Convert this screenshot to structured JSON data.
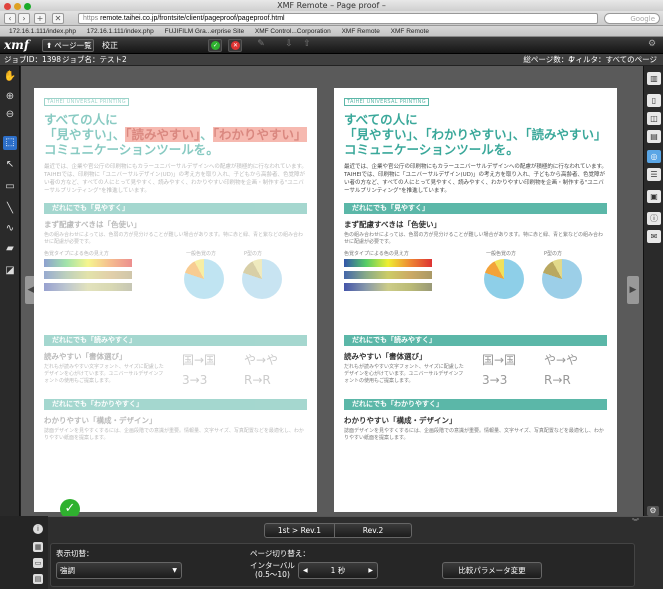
{
  "window": {
    "title": "XMF Remote – Page proof –"
  },
  "browser": {
    "url_prefix": "https",
    "url": "remote.taihei.co.jp/frontsite/client/pageproof/pageproof.html",
    "search_placeholder": "Google"
  },
  "bookmarks": [
    "172.16.1.111/index.php",
    "172.16.1.111/index.php",
    "FUJIFILM Gra...erprise Site",
    "XMF Control...Corporation",
    "XMF Remote",
    "XMF Remote"
  ],
  "toolbar": {
    "logo": "xmf",
    "page_list_label": "ページ一覧",
    "mode_label": "校正"
  },
  "info": {
    "job_id": "ジョブID：1398",
    "job_name": "ジョブ名：テスト2",
    "total_pages": "総ページ数：4",
    "filter": "フィルタ：すべてのページ"
  },
  "page": {
    "brand": "TAIHEI UNIVERSAL PRINTING",
    "title_line1": "すべての人に",
    "title_q1": "「見やすい」、",
    "title_q2": "「読みやすい」",
    "title_sep": "、",
    "title_q3": "「わかりやすい」",
    "title_line3": "コミュニケーションツールを。",
    "intro": "最近では、企業や官公庁の印刷物にもカラーユニバーサルデザインへの配慮が積極的に行なわれています。TAIHEIでは、印刷物に「ユニバーサルデザイン(UD)」の考え方を取り入れ、子どもから高齢者、色覚障がい者の方など、すべての人にとって見やすく、読みやすく、わかりやすい印刷物を企画・制作する\"ユニバーサルプリンティング\"を推進しています。",
    "sec1_band": "だれにでも「見やすく」",
    "sec1_sub": "まず配慮すべきは「色使い」",
    "sec1_text": "色の組み合わせによっては、色弱の方が見分けることが難しい場合があります。特に赤と緑、青と紫などの組み合わせに配慮が必要です。",
    "chart_label_a": "色覚タイプによる色の見え方",
    "chart_label_b": "一般色覚の方",
    "chart_label_c": "P型の方",
    "sec2_band": "だれにでも「読みやすく」",
    "sec2_sub": "読みやすい「書体選び」",
    "sec2_text": "だれもが読みやすい文字フォント、サイズに配慮したデザインを心がけています。ユニバーサルデザインフォントの使用もご提案します。",
    "glyph1": "国→国",
    "glyph2": "や→や",
    "glyph3": "3→3",
    "glyph4": "R→R",
    "sec3_band": "だれにでも「わかりやすく」",
    "sec3_sub": "わかりやすい「構成・デザイン」",
    "sec3_text": "誌面デザインを見やすくするには、企画段階での意識が重要。情報量、文字サイズ、写真配置などを最適化し、わかりやすい紙面を提案します。"
  },
  "bottom": {
    "rev1_label": "1st > Rev.1",
    "rev2_label": "Rev.2",
    "display_switch_label": "表示切替：",
    "display_mode": "強調",
    "page_switch_label": "ページ切り替え：",
    "interval_label": "インターバル",
    "interval_range": "(0.5〜10)",
    "interval_value": "1 秒",
    "compare_button": "比較パラメータ変更"
  },
  "colors": {
    "accent": "#5bb7a8",
    "highlight": "#f18c7d",
    "selected_tool": "#2d6fc9",
    "approve": "#2fb12f"
  }
}
